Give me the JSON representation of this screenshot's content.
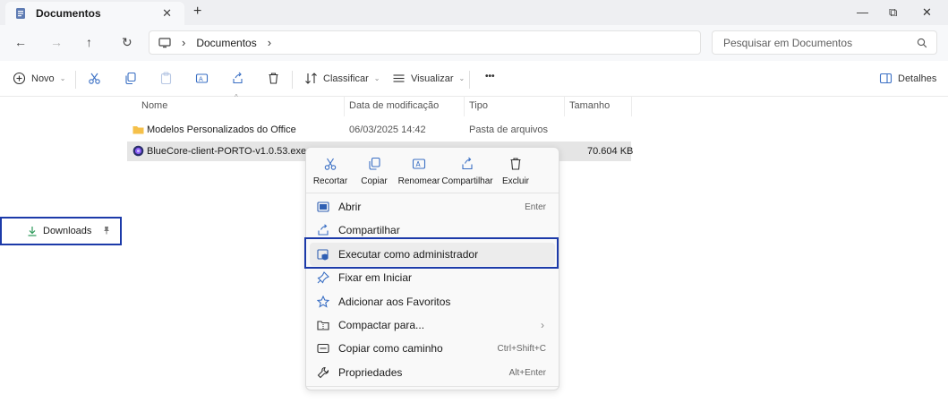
{
  "window": {
    "tab_title": "Documentos",
    "tab_close": "✕",
    "new_tab": "+",
    "minimize": "—",
    "maximize": "⧉",
    "close": "✕"
  },
  "nav": {
    "back": "←",
    "forward": "→",
    "up": "↑",
    "refresh": "↻",
    "breadcrumb_sep": "›",
    "breadcrumb": "Documentos",
    "breadcrumb_end": "›",
    "search_placeholder": "Pesquisar em Documentos"
  },
  "toolbar": {
    "new_label": "Novo",
    "sort_label": "Classificar",
    "view_label": "Visualizar",
    "more": "•••",
    "details_label": "Detalhes",
    "caret": "⌄"
  },
  "columns": {
    "name": "Nome",
    "date": "Data de modificação",
    "type": "Tipo",
    "size": "Tamanho",
    "sort_caret": "^"
  },
  "files": [
    {
      "name": "Modelos Personalizados do Office",
      "date": "06/03/2025 14:42",
      "type": "Pasta de arquivos",
      "size": "",
      "icon": "folder-icon"
    },
    {
      "name": "BlueCore-client-PORTO-v1.0.53.exe",
      "date": "",
      "type": "",
      "size": "70.604 KB",
      "icon": "app-icon"
    }
  ],
  "sidebar": {
    "downloads_label": "Downloads"
  },
  "context_menu": {
    "quick_actions": [
      {
        "label": "Recortar",
        "icon": "cut-icon"
      },
      {
        "label": "Copiar",
        "icon": "copy-icon"
      },
      {
        "label": "Renomear",
        "icon": "rename-icon"
      },
      {
        "label": "Compartilhar",
        "icon": "share-icon"
      },
      {
        "label": "Excluir",
        "icon": "delete-icon"
      }
    ],
    "items": [
      {
        "label": "Abrir",
        "shortcut": "Enter",
        "icon": "open-icon"
      },
      {
        "label": "Compartilhar",
        "shortcut": "",
        "icon": "share-icon"
      },
      {
        "label": "Executar como administrador",
        "shortcut": "",
        "icon": "shield-icon"
      },
      {
        "label": "Fixar em Iniciar",
        "shortcut": "",
        "icon": "pin-icon"
      },
      {
        "label": "Adicionar aos Favoritos",
        "shortcut": "",
        "icon": "star-icon"
      },
      {
        "label": "Compactar para...",
        "shortcut": "",
        "icon": "zip-icon",
        "submenu_arrow": "›"
      },
      {
        "label": "Copiar como caminho",
        "shortcut": "Ctrl+Shift+C",
        "icon": "path-icon"
      },
      {
        "label": "Propriedades",
        "shortcut": "Alt+Enter",
        "icon": "wrench-icon"
      }
    ]
  },
  "colors": {
    "accent_box": "#1c3aa9",
    "folder": "#f5c04a",
    "download_icon": "#2d9a5a"
  }
}
